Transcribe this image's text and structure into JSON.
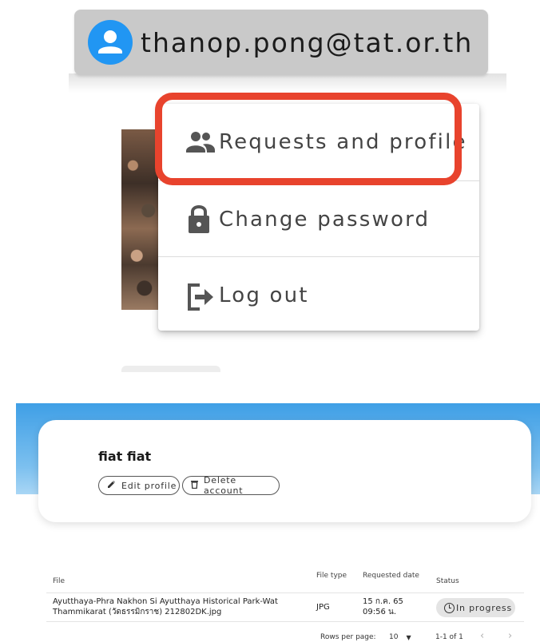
{
  "user_chip": {
    "email": "thanop.pong@tat.or.th",
    "avatar_color": "#2196f3"
  },
  "menu": {
    "items": [
      {
        "label": "Requests and profile",
        "icon": "people-icon"
      },
      {
        "label": "Change password",
        "icon": "lock-icon"
      },
      {
        "label": "Log out",
        "icon": "logout-icon"
      }
    ],
    "highlight_color": "#e8432d"
  },
  "profile": {
    "name": "fiat fiat",
    "edit_label": "Edit profile",
    "delete_label": "Delete account"
  },
  "table": {
    "headers": {
      "file": "File",
      "file_type": "File type",
      "requested_date": "Requested date",
      "status": "Status"
    },
    "rows": [
      {
        "file_line1": "Ayutthaya-Phra Nakhon Si Ayutthaya Historical Park-Wat",
        "file_line2": "Thammikarat (วัดธรรมิกราช) 212802DK.jpg",
        "file_type": "JPG",
        "date_line1": "15 ก.ค. 65",
        "date_line2": "09:56 น.",
        "status": "In progress"
      }
    ],
    "footer": {
      "rows_per_page_label": "Rows per page:",
      "rows_per_page_value": "10",
      "range": "1-1 of 1"
    }
  }
}
